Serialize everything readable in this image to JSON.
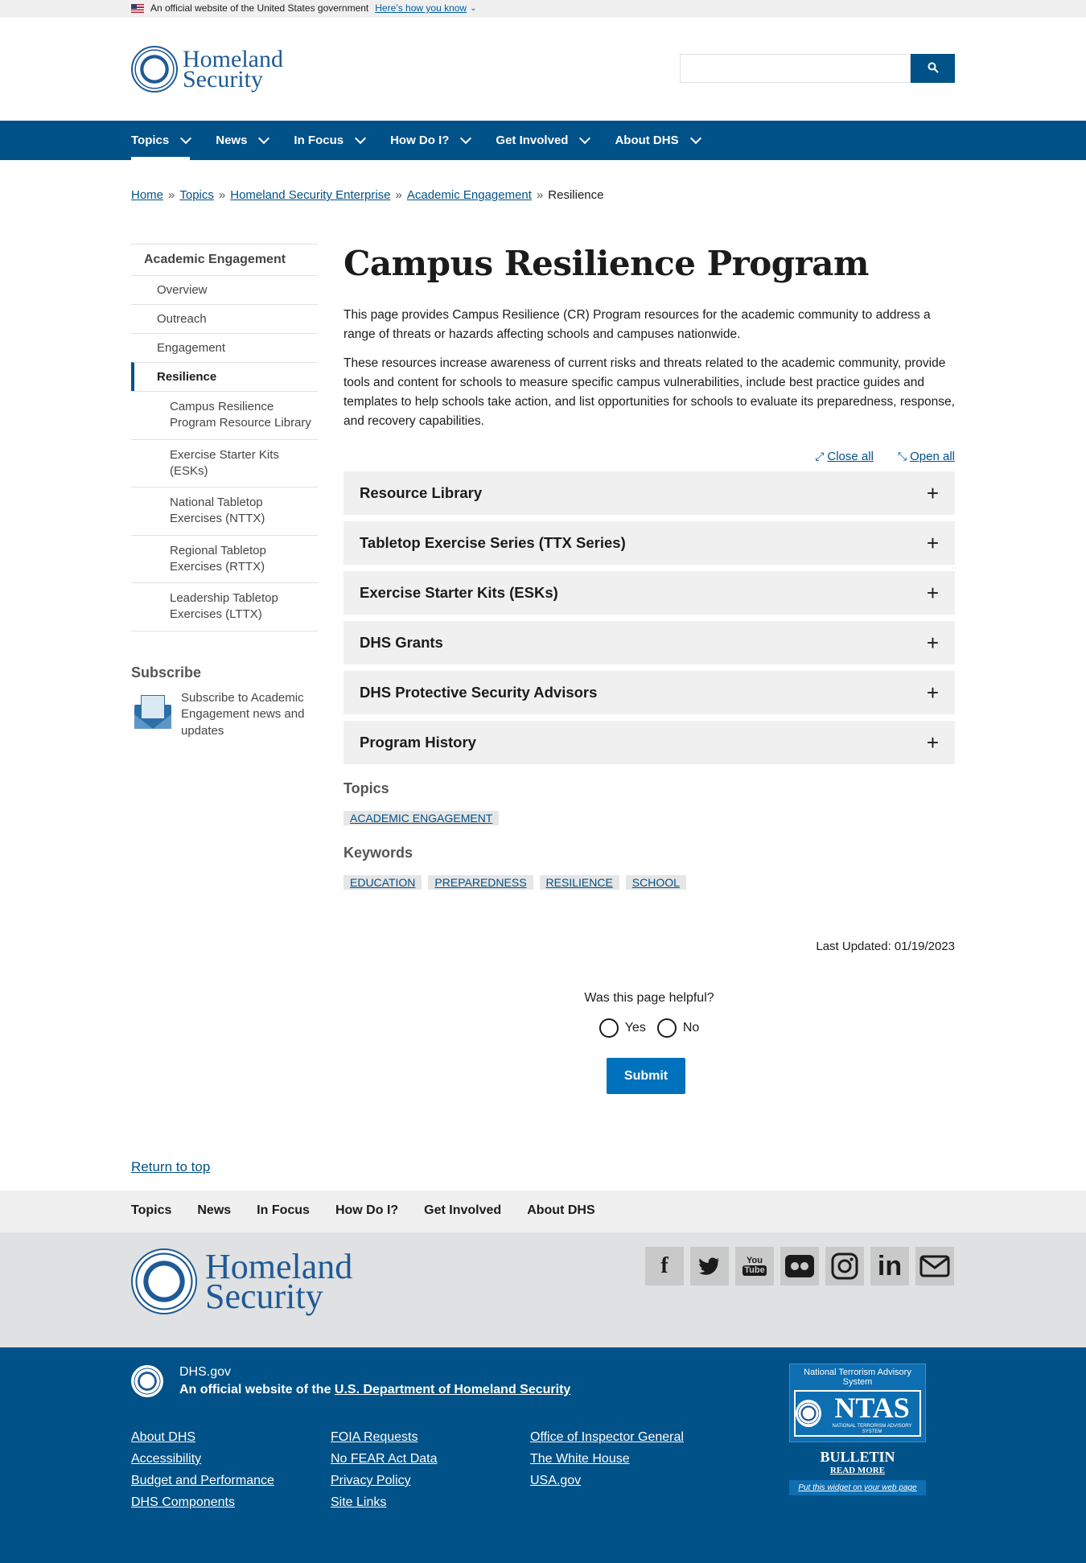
{
  "gov_banner": {
    "text": "An official website of the United States government",
    "link": "Here’s how you know"
  },
  "logo": {
    "line1": "Homeland",
    "line2": "Security"
  },
  "search": {
    "button_icon": "search-icon"
  },
  "nav": {
    "items": [
      "Topics",
      "News",
      "In Focus",
      "How Do I?",
      "Get Involved",
      "About DHS"
    ],
    "active": "Topics"
  },
  "breadcrumb": [
    "Home",
    "Topics",
    "Homeland Security Enterprise",
    "Academic Engagement",
    "Resilience"
  ],
  "sidenav": {
    "title": "Academic Engagement",
    "items": [
      "Overview",
      "Outreach",
      "Engagement",
      "Resilience"
    ],
    "sub_items": [
      "Campus Resilience Program Resource Library",
      "Exercise Starter Kits (ESKs)",
      "National Tabletop Exercises (NTTX)",
      "Regional Tabletop Exercises (RTTX)",
      "Leadership Tabletop Exercises (LTTX)"
    ],
    "subscribe_heading": "Subscribe",
    "subscribe_text": "Subscribe to Academic Engagement news and updates"
  },
  "main": {
    "title": "Campus Resilience Program",
    "para1": "This page provides Campus Resilience (CR) Program resources for the academic community to address a range of threats or hazards affecting schools and campuses nationwide.",
    "para2": "These resources increase awareness of current risks and threats related to the academic community, provide tools and content for schools to measure specific campus vulnerabilities, include best practice guides and templates to help schools take action, and list opportunities for schools to evaluate its preparedness, response, and recovery capabilities.",
    "close_all": "Close all",
    "open_all": "Open all",
    "accordion": [
      "Resource Library",
      "Tabletop Exercise Series (TTX Series)",
      "Exercise Starter Kits (ESKs)",
      "DHS Grants",
      "DHS Protective Security Advisors",
      "Program History"
    ],
    "topics_heading": "Topics",
    "topics": [
      "ACADEMIC ENGAGEMENT"
    ],
    "keywords_heading": "Keywords",
    "keywords": [
      "EDUCATION",
      "PREPAREDNESS",
      "RESILIENCE",
      "SCHOOL"
    ],
    "last_updated": "Last Updated: 01/19/2023"
  },
  "feedback": {
    "question": "Was this page helpful?",
    "yes": "Yes",
    "no": "No",
    "submit": "Submit"
  },
  "return_to_top": "Return to top",
  "footer": {
    "nav": [
      "Topics",
      "News",
      "In Focus",
      "How Do I?",
      "Get Involved",
      "About DHS"
    ],
    "social": [
      "facebook-icon",
      "twitter-icon",
      "youtube-icon",
      "flickr-icon",
      "instagram-icon",
      "linkedin-icon",
      "email-icon"
    ],
    "site": "DHS.gov",
    "official_prefix": "An official website of the ",
    "official_link": "U.S. Department of Homeland Security",
    "links": [
      "About DHS",
      "FOIA Requests",
      "Office of Inspector General",
      "Accessibility",
      "No FEAR Act Data",
      "The White House",
      "Budget and Performance",
      "Privacy Policy",
      "USA.gov",
      "DHS Components",
      "Site Links"
    ],
    "ntas": {
      "title": "National Terrorism Advisory System",
      "logo": "NTAS",
      "logo_sub": "NATIONAL TERRORISM ADVISORY SYSTEM",
      "bulletin": "BULLETIN",
      "read_more": "READ MORE",
      "widget": "Put this widget on your web page"
    }
  },
  "colors": {
    "primary": "#005288",
    "button": "#0071bc",
    "light_bg": "#f0f0f0"
  }
}
